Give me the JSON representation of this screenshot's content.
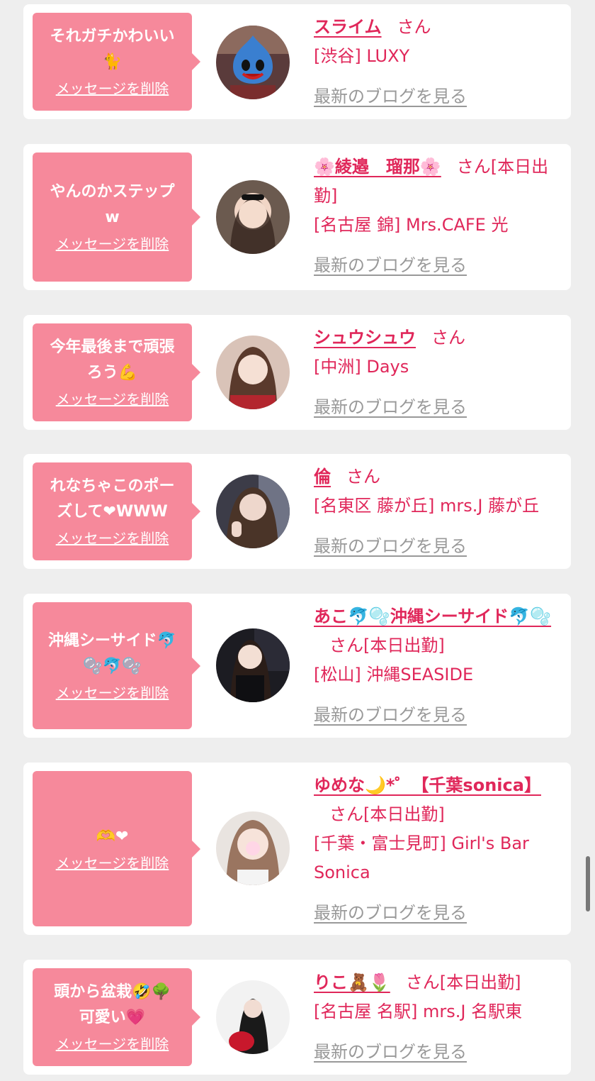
{
  "delete_label": "メッセージを削除",
  "blog_label": "最新のブログを見る",
  "san_label": "さん",
  "colors": {
    "bubble": "#f6899b",
    "accent": "#e0275a",
    "muted": "#999999",
    "background": "#eeeeee"
  },
  "messages": [
    {
      "message": "それガチかわいい\n🐈",
      "name": "スライム",
      "suffix": "さん",
      "shop": "[渋谷] LUXY",
      "avatar_theme": "slime-avatar"
    },
    {
      "message": "やんのかステップ\nw",
      "name": "🌸綾邉　瑠那🌸",
      "suffix": "さん[本日出勤]",
      "shop": "[名古屋 錦] Mrs.CAFE 光",
      "avatar_theme": "girl-avatar"
    },
    {
      "message": "今年最後まで頑張\nろう💪",
      "name": "シュウシュウ",
      "suffix": "さん",
      "shop": "[中洲] Days",
      "avatar_theme": "girl-avatar"
    },
    {
      "message": "れなちゃこのポー\nズして❤WWW",
      "name": "倫",
      "suffix": "さん",
      "shop": "[名東区 藤が丘] mrs.J 藤が丘",
      "avatar_theme": "girl-avatar"
    },
    {
      "message": "沖縄シーサイド🐬\n🫧🐬🫧",
      "name": "あこ🐬🫧沖縄シーサイド🐬🫧",
      "suffix": "さん[本日出勤]",
      "shop": "[松山] 沖縄SEASIDE",
      "avatar_theme": "girl-avatar"
    },
    {
      "message": "🫶❤",
      "name": "ゆめな🌙*゜【千葉sonica】",
      "suffix": "さん[本日出勤]",
      "shop": "[千葉・富士見町] Girl's Bar Sonica",
      "avatar_theme": "girl-avatar"
    },
    {
      "message": "頭から盆栽🤣🌳\n可愛い💗",
      "name": "りこ🧸🌷",
      "suffix": "さん[本日出勤]",
      "shop": "[名古屋 名駅] mrs.J 名駅東",
      "avatar_theme": "girl-avatar"
    }
  ]
}
